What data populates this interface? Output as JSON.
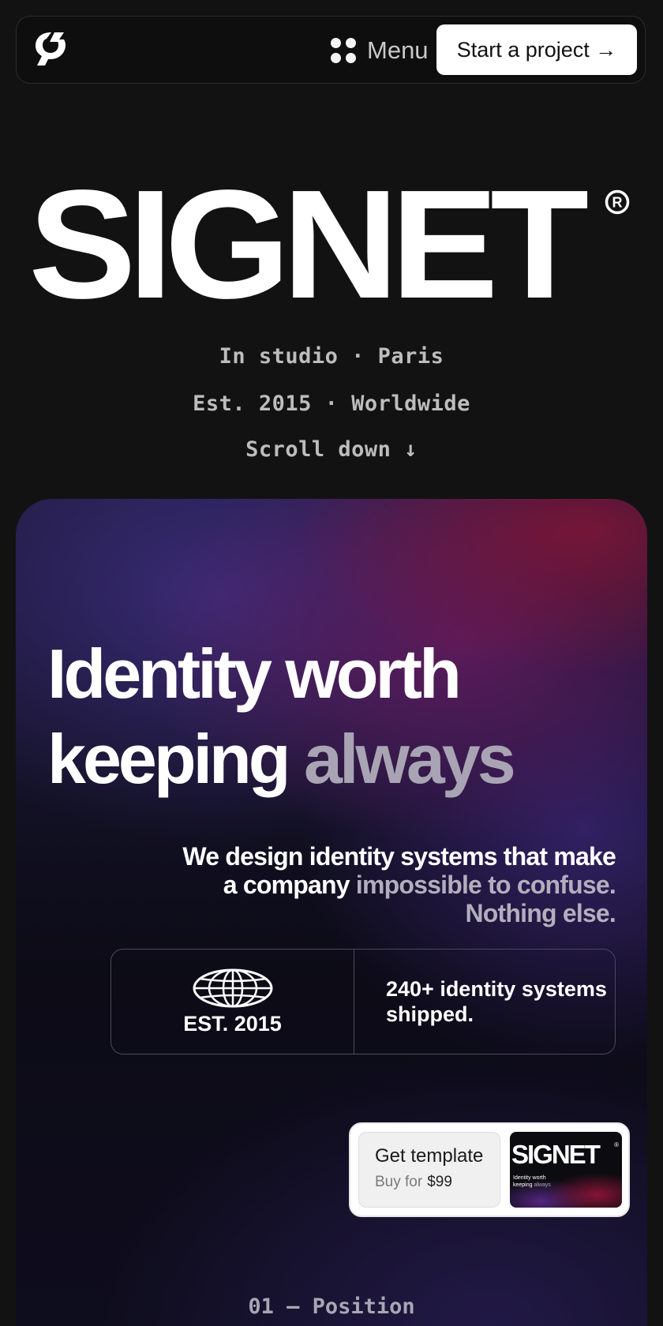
{
  "header": {
    "menu_label": "Menu",
    "cta_label": "Start a project →"
  },
  "brand": {
    "wordmark": "SIGNET",
    "registered_mark": "®"
  },
  "intro": {
    "line1": "In studio · Paris",
    "line2": "Est. 2015 · Worldwide",
    "line3": "Scroll down ↓"
  },
  "hero": {
    "title_line1": "Identity worth",
    "title_line2_main": "keeping",
    "title_line2_muted": "always",
    "subtitle_main": "We design identity systems that make a company",
    "subtitle_muted": "impossible to confuse. Nothing else.",
    "stat_left_label": "EST. 2015",
    "stat_right": "240+ identity systems shipped."
  },
  "template_card": {
    "title": "Get template",
    "buy_prefix": "Buy for",
    "price": "$99",
    "thumb_wordmark": "SIGNET",
    "thumb_line1": "Identity worth",
    "thumb_line2": "keeping",
    "thumb_line2_muted": "always"
  },
  "section": {
    "label": "01 — Position"
  },
  "colors": {
    "background": "#121212",
    "cta_bg": "#ffffff",
    "muted_text": "#a9a4b4"
  },
  "icons": [
    "signet-logo-icon",
    "menu-dots-icon",
    "registered-icon",
    "globe-icon"
  ]
}
